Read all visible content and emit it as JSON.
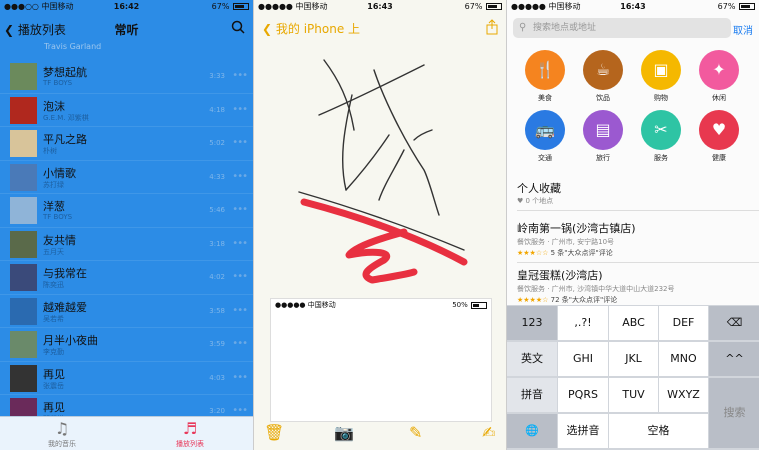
{
  "panel1": {
    "status": {
      "carrier": "●●●○○ 中国移动",
      "time": "16:42",
      "battery": "67%"
    },
    "nav": {
      "back_label": "播放列表",
      "title": "常听"
    },
    "faded_prev": "Travis Garland",
    "songs": [
      {
        "title": "梦想起航",
        "artist": "TF BOYS",
        "duration": "3:33",
        "color": "#6b8a5c"
      },
      {
        "title": "泡沫",
        "artist": "G.E.M. 邓紫棋",
        "duration": "4:18",
        "color": "#b0281e"
      },
      {
        "title": "平凡之路",
        "artist": "朴树",
        "duration": "5:02",
        "color": "#d8c49a"
      },
      {
        "title": "小情歌",
        "artist": "苏打绿",
        "duration": "4:33",
        "color": "#4a7ab8"
      },
      {
        "title": "洋葱",
        "artist": "TF BOYS",
        "duration": "5:46",
        "color": "#8fb4d8"
      },
      {
        "title": "友共情",
        "artist": "五月天",
        "duration": "3:18",
        "color": "#5a6a4a"
      },
      {
        "title": "与我常在",
        "artist": "陈奕迅",
        "duration": "4:02",
        "color": "#3a4a7a"
      },
      {
        "title": "越难越爱",
        "artist": "吴若希",
        "duration": "3:58",
        "color": "#2a6ab0"
      },
      {
        "title": "月半小夜曲",
        "artist": "李克勤",
        "duration": "3:59",
        "color": "#6a8a6a"
      },
      {
        "title": "再见",
        "artist": "张震岳",
        "duration": "4:03",
        "color": "#333333"
      },
      {
        "title": "再见",
        "artist": "邓紫棋",
        "duration": "3:20",
        "color": "#6a2a5a"
      }
    ],
    "tabs": [
      {
        "label": "我的音乐",
        "icon": "♫"
      },
      {
        "label": "播放列表",
        "icon": "♬"
      }
    ]
  },
  "panel2": {
    "status": {
      "carrier": "●●●●● 中国移动",
      "time": "16:43",
      "battery": "67%"
    },
    "nav": {
      "back_label": "我的 iPhone 上"
    },
    "inner_status": {
      "carrier": "●●●●● 中国移动",
      "battery": "50%"
    }
  },
  "panel3": {
    "status": {
      "carrier": "●●●●● 中国移动",
      "time": "16:43",
      "battery": "67%"
    },
    "search": {
      "placeholder": "搜索地点或地址",
      "cancel": "取消"
    },
    "categories": [
      {
        "label": "美食",
        "color": "#f5841f",
        "icon": "🍴"
      },
      {
        "label": "饮品",
        "color": "#b5651d",
        "icon": "☕"
      },
      {
        "label": "购物",
        "color": "#f5b800",
        "icon": "▣"
      },
      {
        "label": "休闲",
        "color": "#f25a9e",
        "icon": "✦"
      },
      {
        "label": "交通",
        "color": "#2a7ae2",
        "icon": "🚌"
      },
      {
        "label": "旅行",
        "color": "#9b59d0",
        "icon": "▤"
      },
      {
        "label": "服务",
        "color": "#2ec4a4",
        "icon": "✂"
      },
      {
        "label": "健康",
        "color": "#e8384f",
        "icon": "♥"
      }
    ],
    "favorites": {
      "title": "个人收藏",
      "sub": "♥ 0 个地点"
    },
    "results": [
      {
        "name": "岭南第一锅(沙湾古镇店)",
        "detail": "餐饮服务 · 广州市, 安宁路10号",
        "stars": "★★★☆☆",
        "reviews": "5 条\"大众点评\"评论"
      },
      {
        "name": "皇冠蛋糕(沙湾店)",
        "detail": "餐饮服务 · 广州市, 沙湾镇中华大道中山大道232号",
        "stars": "★★★★☆",
        "reviews": "72 条\"大众点评\"评论"
      }
    ],
    "keyboard": {
      "r1": [
        "123",
        ",.?!",
        "ABC",
        "DEF",
        "⌫"
      ],
      "r2": [
        "英文",
        "GHI",
        "JKL",
        "MNO",
        "^^"
      ],
      "r3": [
        "拼音",
        "PQRS",
        "TUV",
        "WXYZ",
        "搜索"
      ],
      "r4": [
        "🌐",
        "选拼音",
        "空格"
      ]
    }
  }
}
